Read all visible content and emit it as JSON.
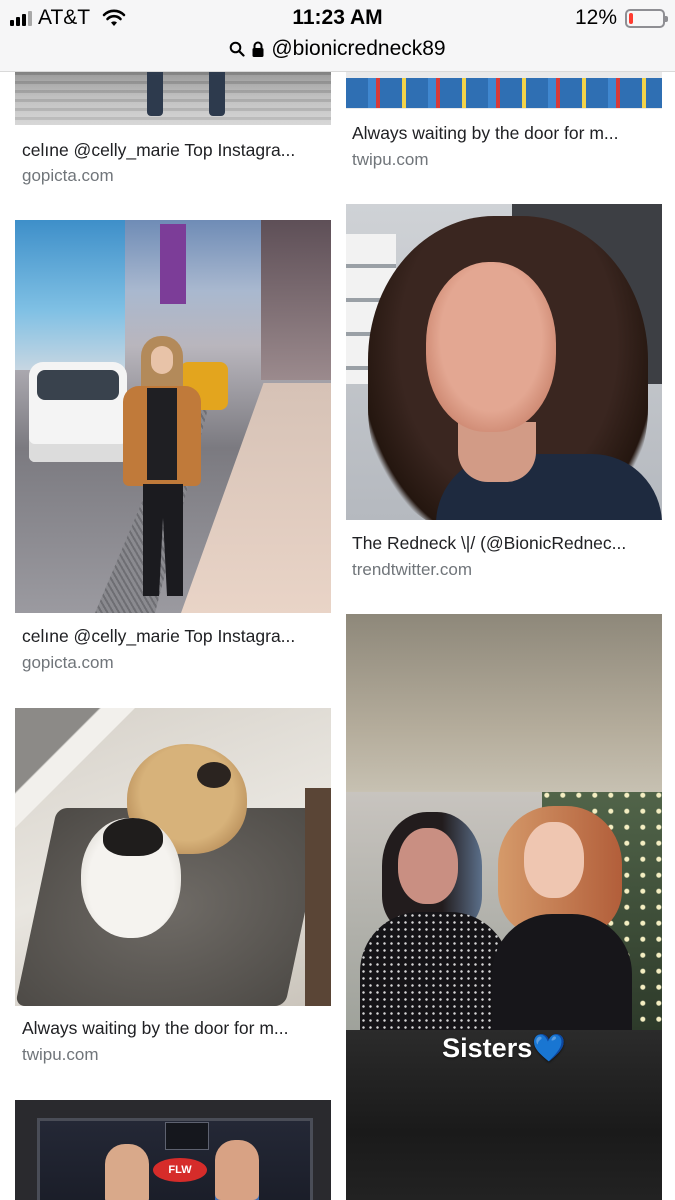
{
  "status_bar": {
    "carrier": "AT&T",
    "time": "11:23 AM",
    "battery_percent_label": "12%",
    "battery_level": 0.12,
    "battery_color": "#ff3b30"
  },
  "url_bar": {
    "text": "@bionicredneck89",
    "icons": [
      "search-icon",
      "lock-icon"
    ]
  },
  "results": [
    {
      "caption": "celıne @celly_marie Top Instagra...",
      "source": "gopicta.com",
      "image": "stairs-photo"
    },
    {
      "caption": "Always waiting by the door for m...",
      "source": "twipu.com",
      "image": "wrapping-paper-photo"
    },
    {
      "caption": "celıne @celly_marie Top Instagra...",
      "source": "gopicta.com",
      "image": "times-square-photo"
    },
    {
      "caption": "The Redneck \\|/ (@BionicRednec...",
      "source": "trendtwitter.com",
      "image": "selfie-photo"
    },
    {
      "caption": "Always waiting by the door for m...",
      "source": "twipu.com",
      "image": "dogs-photo"
    },
    {
      "caption": "",
      "source": "",
      "image": "sisters-photo",
      "overlay_text": "Sisters💙"
    },
    {
      "caption": "",
      "source": "",
      "image": "fishing-photo",
      "overlay_text": "FLW"
    }
  ]
}
